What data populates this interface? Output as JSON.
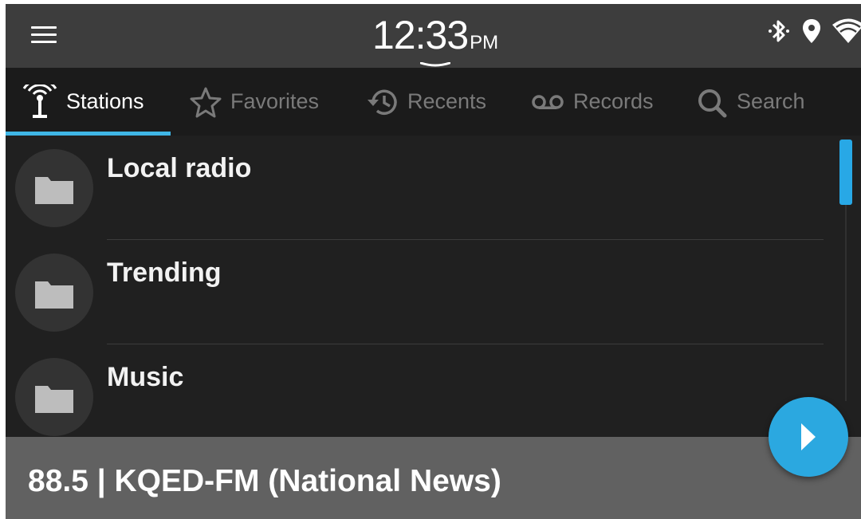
{
  "status_bar": {
    "time": "12:33",
    "ampm": "PM",
    "icons": [
      "bluetooth-icon",
      "location-icon",
      "wifi-icon"
    ]
  },
  "tabs": [
    {
      "label": "Stations",
      "icon": "antenna-icon",
      "active": true
    },
    {
      "label": "Favorites",
      "icon": "star-icon",
      "active": false
    },
    {
      "label": "Recents",
      "icon": "history-icon",
      "active": false
    },
    {
      "label": "Records",
      "icon": "voicemail-icon",
      "active": false
    },
    {
      "label": "Search",
      "icon": "search-icon",
      "active": false
    }
  ],
  "list": {
    "items": [
      {
        "label": "Local radio",
        "icon": "folder-icon"
      },
      {
        "label": "Trending",
        "icon": "folder-icon"
      },
      {
        "label": "Music",
        "icon": "folder-icon"
      }
    ]
  },
  "now_playing": {
    "text": "88.5 | KQED-FM (National News)"
  },
  "colors": {
    "accent": "#3fb6e6",
    "fab": "#2ba8e0",
    "background": "#202020",
    "status_bar": "#3d3d3d",
    "now_playing_bar": "#616161"
  }
}
